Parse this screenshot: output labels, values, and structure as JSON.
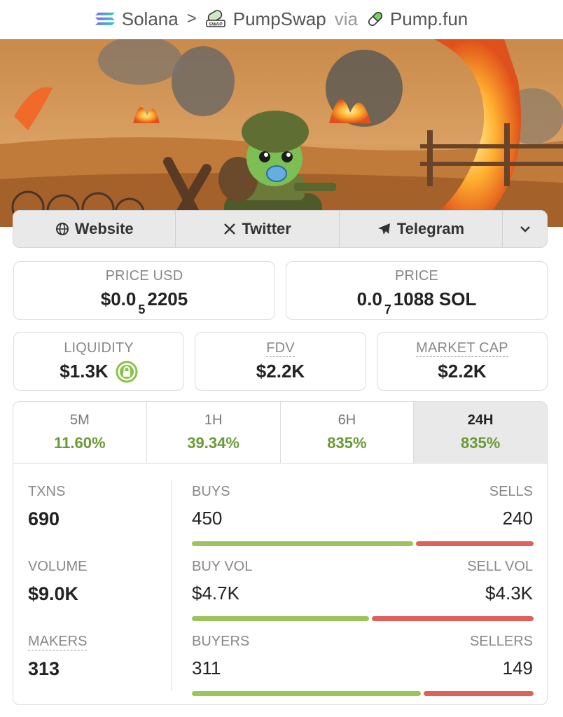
{
  "breadcrumb": {
    "chain": "Solana",
    "separator": ">",
    "dex": "PumpSwap",
    "via": "via",
    "launchpad": "Pump.fun"
  },
  "links": {
    "website": "Website",
    "twitter": "Twitter",
    "telegram": "Telegram"
  },
  "price_usd": {
    "label": "PRICE USD",
    "prefix": "$0.0",
    "zeros": "5",
    "digits": "2205"
  },
  "price_native": {
    "label": "PRICE",
    "prefix": "0.0",
    "zeros": "7",
    "digits": "1088 SOL"
  },
  "liquidity": {
    "label": "LIQUIDITY",
    "value": "$1.3K"
  },
  "fdv": {
    "label": "FDV",
    "value": "$2.2K"
  },
  "market_cap": {
    "label": "MARKET CAP",
    "value": "$2.2K"
  },
  "timeframes": [
    {
      "label": "5M",
      "value": "11.60%"
    },
    {
      "label": "1H",
      "value": "39.34%"
    },
    {
      "label": "6H",
      "value": "835%"
    },
    {
      "label": "24H",
      "value": "835%"
    }
  ],
  "stats": {
    "txns": {
      "label": "TXNS",
      "value": "690"
    },
    "volume": {
      "label": "VOLUME",
      "value": "$9.0K"
    },
    "makers": {
      "label": "MAKERS",
      "value": "313"
    },
    "buys": {
      "label": "BUYS",
      "value": "450",
      "ratio": 0.652
    },
    "sells": {
      "label": "SELLS",
      "value": "240"
    },
    "buy_vol": {
      "label": "BUY VOL",
      "value": "$4.7K",
      "ratio": 0.522
    },
    "sell_vol": {
      "label": "SELL VOL",
      "value": "$4.3K"
    },
    "buyers": {
      "label": "BUYERS",
      "value": "311",
      "ratio": 0.676
    },
    "sellers": {
      "label": "SELLERS",
      "value": "149"
    }
  },
  "colors": {
    "positive": "#6a9a34",
    "buy_bar": "#9bc45a",
    "sell_bar": "#e0605a",
    "lock_green": "#8bc34a"
  }
}
